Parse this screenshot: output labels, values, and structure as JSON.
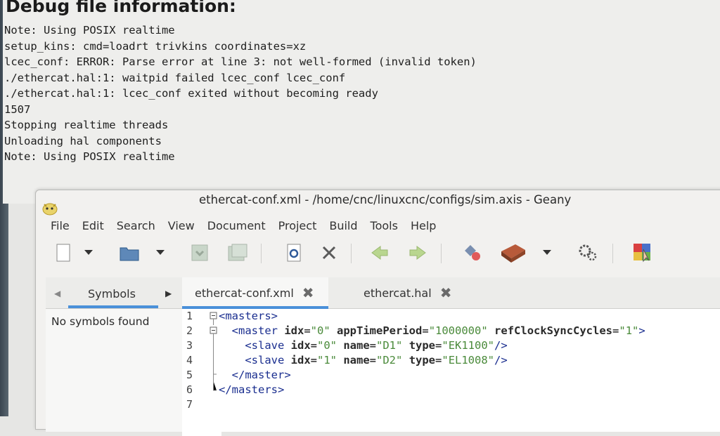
{
  "debug": {
    "title": "Debug file information:",
    "lines": [
      "Note: Using POSIX realtime",
      "setup_kins: cmd=loadrt trivkins coordinates=xz",
      "lcec_conf: ERROR: Parse error at line 3: not well-formed (invalid token)",
      "./ethercat.hal:1: waitpid failed lcec_conf lcec_conf",
      "./ethercat.hal:1: lcec_conf exited without becoming ready",
      "1507",
      "Stopping realtime threads",
      "Unloading hal components",
      "Note: Using POSIX realtime"
    ]
  },
  "window": {
    "title": "ethercat-conf.xml - /home/cnc/linuxcnc/configs/sim.axis - Geany",
    "menu": [
      "File",
      "Edit",
      "Search",
      "View",
      "Document",
      "Project",
      "Build",
      "Tools",
      "Help"
    ],
    "toolbar_icons": [
      "new-file-icon",
      "new-dropdown-icon",
      "open-file-icon",
      "open-dropdown-icon",
      "save-icon",
      "save-all-icon",
      "reload-icon",
      "close-file-icon",
      "back-icon",
      "forward-icon",
      "compile-icon",
      "build-icon",
      "build-dropdown-icon",
      "execute-icon",
      "color-chooser-icon"
    ]
  },
  "sidebar": {
    "tab_label": "Symbols",
    "empty_message": "No symbols found"
  },
  "tabs": [
    {
      "label": "ethercat-conf.xml",
      "active": true
    },
    {
      "label": "ethercat.hal",
      "active": false
    }
  ],
  "editor": {
    "line_numbers": [
      "1",
      "2",
      "3",
      "4",
      "5",
      "6",
      "7"
    ],
    "lines": [
      [
        {
          "t": "tag",
          "v": "<masters>"
        }
      ],
      [
        {
          "t": "tag",
          "v": "  <master "
        },
        {
          "t": "attr",
          "v": "idx"
        },
        {
          "t": "plain",
          "v": "="
        },
        {
          "t": "val",
          "v": "\"0\""
        },
        {
          "t": "plain",
          "v": " "
        },
        {
          "t": "attr",
          "v": "appTimePeriod"
        },
        {
          "t": "plain",
          "v": "="
        },
        {
          "t": "val",
          "v": "\"1000000\""
        },
        {
          "t": "plain",
          "v": " "
        },
        {
          "t": "attr",
          "v": "refClockSyncCycles"
        },
        {
          "t": "plain",
          "v": "="
        },
        {
          "t": "val",
          "v": "\"1\""
        },
        {
          "t": "tag",
          "v": ">"
        }
      ],
      [
        {
          "t": "tag",
          "v": "    <slave "
        },
        {
          "t": "attr",
          "v": "idx"
        },
        {
          "t": "plain",
          "v": "="
        },
        {
          "t": "val",
          "v": "\"0\""
        },
        {
          "t": "plain",
          "v": " "
        },
        {
          "t": "attr",
          "v": "name"
        },
        {
          "t": "plain",
          "v": "="
        },
        {
          "t": "val",
          "v": "\"D1\""
        },
        {
          "t": "plain",
          "v": " "
        },
        {
          "t": "attr",
          "v": "type"
        },
        {
          "t": "plain",
          "v": "="
        },
        {
          "t": "val",
          "v": "\"EK1100\""
        },
        {
          "t": "tag",
          "v": "/>"
        }
      ],
      [
        {
          "t": "tag",
          "v": "    <slave "
        },
        {
          "t": "attr",
          "v": "idx"
        },
        {
          "t": "plain",
          "v": "="
        },
        {
          "t": "val",
          "v": "\"1\""
        },
        {
          "t": "plain",
          "v": " "
        },
        {
          "t": "attr",
          "v": "name"
        },
        {
          "t": "plain",
          "v": "="
        },
        {
          "t": "val",
          "v": "\"D2\""
        },
        {
          "t": "plain",
          "v": " "
        },
        {
          "t": "attr",
          "v": "type"
        },
        {
          "t": "plain",
          "v": "="
        },
        {
          "t": "val",
          "v": "\"EL1008\""
        },
        {
          "t": "tag",
          "v": "/>"
        }
      ],
      [
        {
          "t": "tag",
          "v": "  </master>"
        }
      ],
      [
        {
          "t": "tag",
          "v": "</masters>"
        }
      ],
      []
    ]
  },
  "colors": {
    "accent": "#4a90d9",
    "xml_tag": "#1a2e8f",
    "xml_value": "#4a8a3a"
  }
}
